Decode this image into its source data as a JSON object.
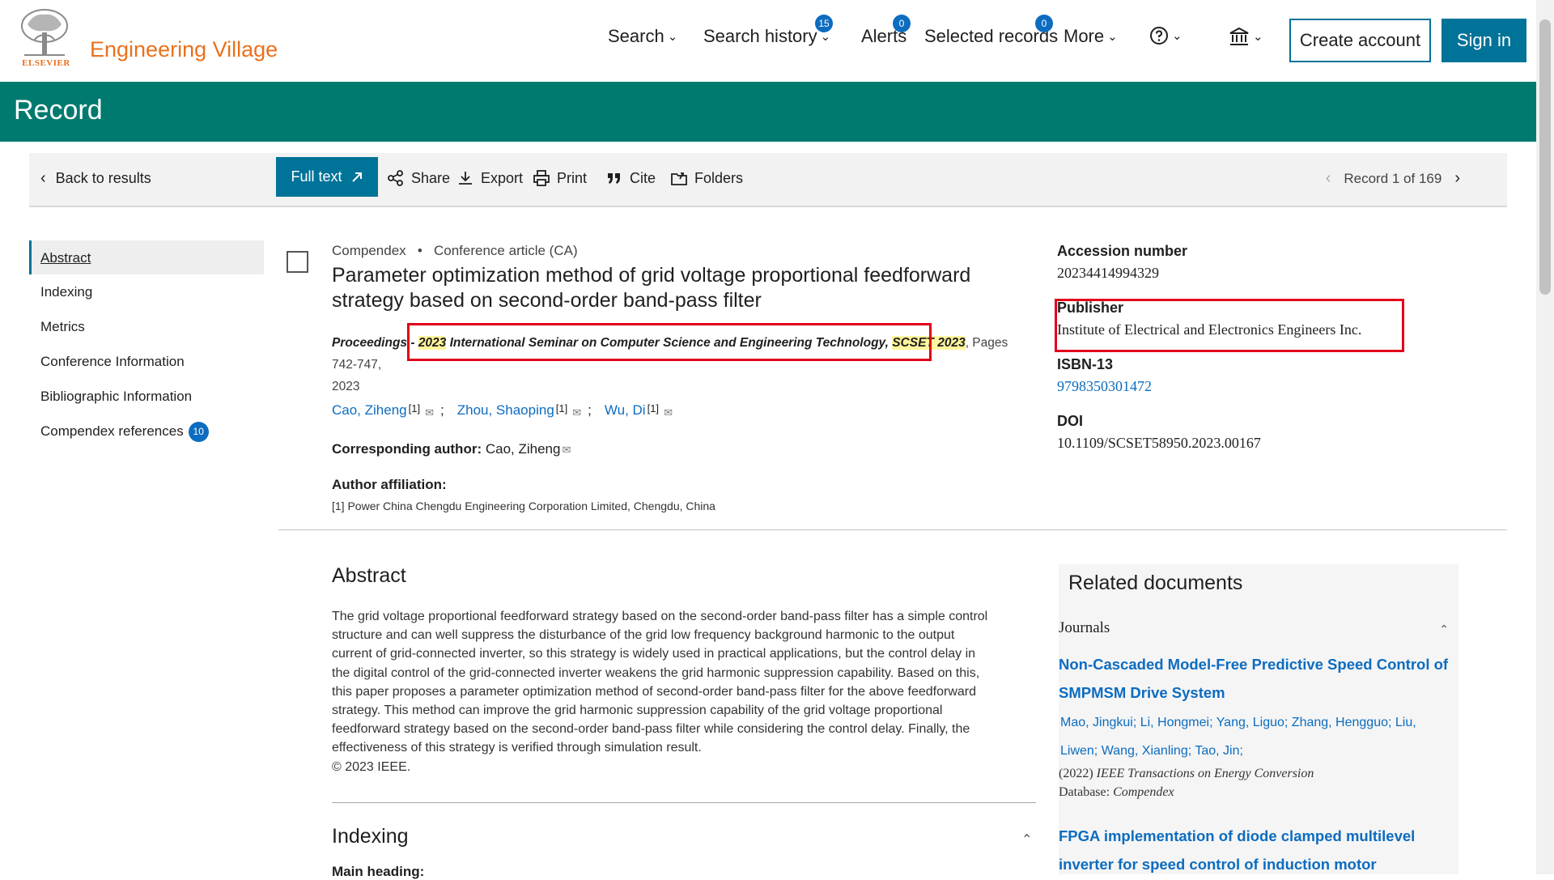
{
  "header": {
    "logo_text": "ELSEVIER",
    "app_name": "Engineering Village",
    "nav": {
      "search": "Search",
      "search_history": "Search history",
      "search_history_badge": "15",
      "alerts": "Alerts",
      "alerts_badge": "0",
      "selected_records": "Selected records",
      "selected_records_badge": "0",
      "more": "More"
    },
    "create_account": "Create account",
    "sign_in": "Sign in"
  },
  "banner": {
    "title": "Record"
  },
  "toolbar": {
    "back": "Back to results",
    "full_text": "Full text",
    "share": "Share",
    "export": "Export",
    "print": "Print",
    "cite": "Cite",
    "folders": "Folders",
    "record_position": "Record 1 of 169"
  },
  "sidenav": {
    "items": [
      "Abstract",
      "Indexing",
      "Metrics",
      "Conference Information",
      "Bibliographic Information",
      "Compendex references"
    ],
    "references_count": "10"
  },
  "record": {
    "database": "Compendex",
    "doc_type": "Conference article (CA)",
    "title": "Parameter optimization method of grid voltage proportional feedforward strategy based on second-order band-pass filter",
    "source_prefix": "Proceedings - ",
    "source_year": "2023",
    "source_mid": " International Seminar on Computer Science and Engineering Technology, ",
    "source_acronym": "SCSET 2023",
    "source_pages": ", Pages 742-747,",
    "source_year2": "2023",
    "authors": [
      {
        "name": "Cao, Ziheng",
        "aff": "[1]"
      },
      {
        "name": "Zhou, Shaoping",
        "aff": "[1]"
      },
      {
        "name": "Wu, Di",
        "aff": "[1]"
      }
    ],
    "corresponding_label": "Corresponding author:",
    "corresponding_name": "Cao, Ziheng",
    "affiliation_label": "Author affiliation:",
    "affiliation": "[1] Power China Chengdu Engineering Corporation Limited, Chengdu, China"
  },
  "details": {
    "accession_label": "Accession number",
    "accession": "20234414994329",
    "publisher_label": "Publisher",
    "publisher": "Institute of Electrical and Electronics Engineers Inc.",
    "isbn_label": "ISBN-13",
    "isbn": "9798350301472",
    "doi_label": "DOI",
    "doi": "10.1109/SCSET58950.2023.00167"
  },
  "abstract": {
    "heading": "Abstract",
    "text": "The grid voltage proportional feedforward strategy based on the second-order band-pass filter has a simple control structure and can well suppress the disturbance of the grid low frequency background harmonic to the output current of grid-connected inverter, so this strategy is widely used in practical applications, but the control delay in the digital control of the grid-connected inverter weakens the grid harmonic suppression capability. Based on this, this paper proposes a parameter optimization method of second-order band-pass filter for the above feedforward strategy. This method can improve the grid harmonic suppression capability of the grid voltage proportional feedforward strategy based on the second-order band-pass filter while considering the control delay. Finally, the effectiveness of this strategy is verified through simulation result.",
    "copyright": "© 2023 IEEE."
  },
  "indexing": {
    "heading": "Indexing",
    "main_heading_label": "Main heading:"
  },
  "related": {
    "heading": "Related documents",
    "section": "Journals",
    "doc1_title": "Non-Cascaded Model-Free Predictive Speed Control of SMPMSM Drive System",
    "doc1_authors": "Mao, Jingkui; Li, Hongmei; Yang, Liguo; Zhang, Hengguo; Liu, Liwen; Wang, Xianling; Tao, Jin;",
    "doc1_year": "(2022)",
    "doc1_journal": "IEEE Transactions on Energy Conversion",
    "doc1_db_label": "Database:",
    "doc1_db": "Compendex",
    "doc2_title": "FPGA implementation of diode clamped multilevel inverter for speed control of induction motor"
  },
  "colors": {
    "brand_orange": "#e9711c",
    "teal_banner": "#007a6e",
    "primary_blue": "#007398",
    "link_blue": "#0c6cc0",
    "highlight_red": "#e0001b",
    "highlight_yellow": "#fff59c"
  }
}
